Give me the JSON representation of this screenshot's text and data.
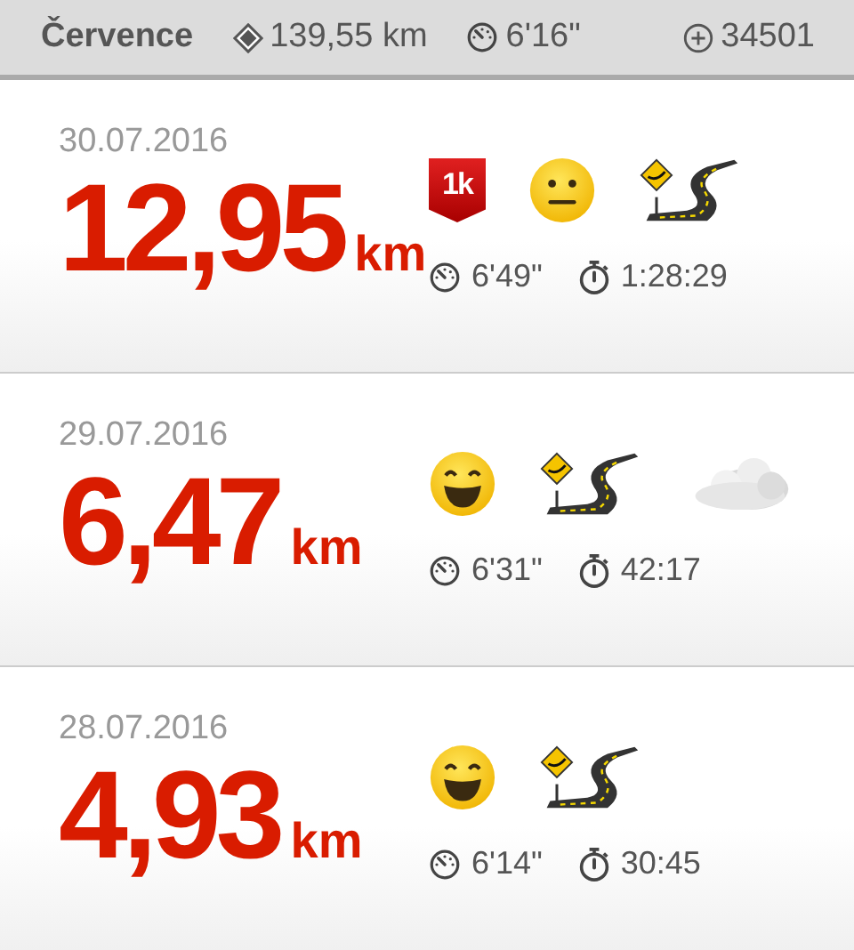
{
  "header": {
    "month": "Července",
    "distance": "139,55 km",
    "pace": "6'16\"",
    "points": "34501"
  },
  "runs": [
    {
      "date": "30.07.2016",
      "distance": "12,95",
      "unit": "km",
      "pace": "6'49\"",
      "duration": "1:28:29",
      "badges": [
        {
          "kind": "milestone",
          "label": "1k"
        },
        {
          "kind": "mood-neutral"
        },
        {
          "kind": "terrain-road"
        }
      ]
    },
    {
      "date": "29.07.2016",
      "distance": "6,47",
      "unit": "km",
      "pace": "6'31\"",
      "duration": "42:17",
      "badges": [
        {
          "kind": "mood-happy"
        },
        {
          "kind": "terrain-road"
        },
        {
          "kind": "weather-cloudy"
        }
      ]
    },
    {
      "date": "28.07.2016",
      "distance": "4,93",
      "unit": "km",
      "pace": "6'14\"",
      "duration": "30:45",
      "badges": [
        {
          "kind": "mood-happy"
        },
        {
          "kind": "terrain-road"
        }
      ]
    }
  ]
}
